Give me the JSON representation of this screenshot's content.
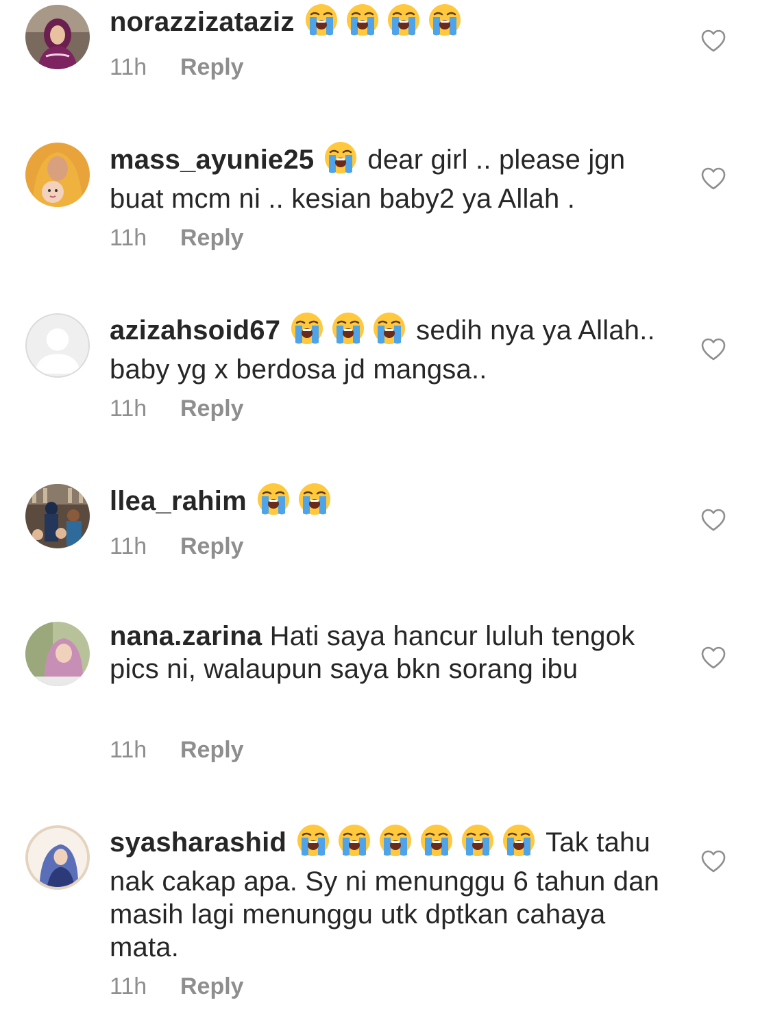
{
  "emoji_name": "loudly-crying-face",
  "colors": {
    "text": "#262626",
    "secondary": "#8e8e8e",
    "emoji_face": "#FFC83D",
    "emoji_tears": "#4FA3E8"
  },
  "comments": [
    {
      "username": "norazzizataziz",
      "emoji_count": 4,
      "text": "",
      "time": "11h",
      "reply_label": "Reply"
    },
    {
      "username": "mass_ayunie25",
      "emoji_count": 1,
      "text": "dear girl .. please jgn buat mcm ni .. kesian baby2 ya Allah .",
      "time": "11h",
      "reply_label": "Reply"
    },
    {
      "username": "azizahsoid67",
      "emoji_count": 3,
      "text": "sedih nya ya Allah.. baby yg x berdosa jd mangsa..",
      "time": "11h",
      "reply_label": "Reply"
    },
    {
      "username": "llea_rahim",
      "emoji_count": 2,
      "text": "",
      "time": "11h",
      "reply_label": "Reply"
    },
    {
      "username": "nana.zarina",
      "emoji_count": 0,
      "text": "Hati saya hancur luluh tengok pics ni, walaupun saya bkn sorang ibu",
      "time": "11h",
      "reply_label": "Reply"
    },
    {
      "username": "syasharashid",
      "emoji_count": 6,
      "text": "Tak tahu nak cakap apa. Sy ni menunggu 6 tahun dan masih lagi menunggu utk dptkan cahaya mata.",
      "time": "11h",
      "reply_label": "Reply"
    }
  ]
}
